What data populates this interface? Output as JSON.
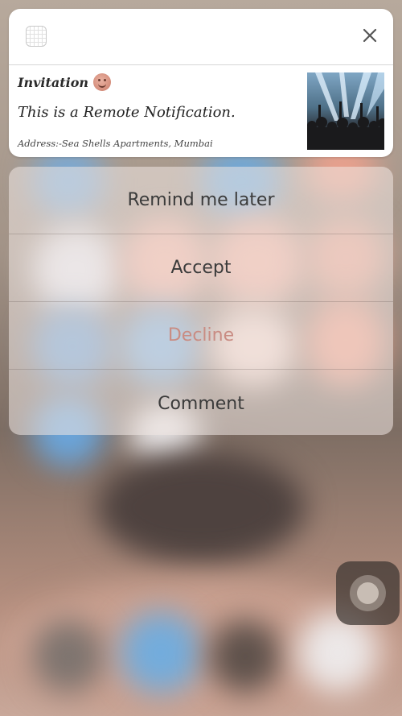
{
  "notification": {
    "title": "Invitation",
    "title_emoji": "smiling-face-emoji",
    "message": "This is a Remote Notification.",
    "address": "Address:-Sea Shells Apartments, Mumbai",
    "app_icon": "grid-app-icon",
    "close_icon": "close-icon",
    "thumbnail": "concert-crowd-image"
  },
  "actions": [
    {
      "label": "Remind me later",
      "style": "default"
    },
    {
      "label": "Accept",
      "style": "default"
    },
    {
      "label": "Decline",
      "style": "destructive"
    },
    {
      "label": "Comment",
      "style": "default"
    }
  ],
  "colors": {
    "action_text": "#3b3b3b",
    "destructive_text": "#c98c83",
    "card_background": "#ffffff"
  },
  "assistive_touch_icon": "assistive-touch-icon"
}
